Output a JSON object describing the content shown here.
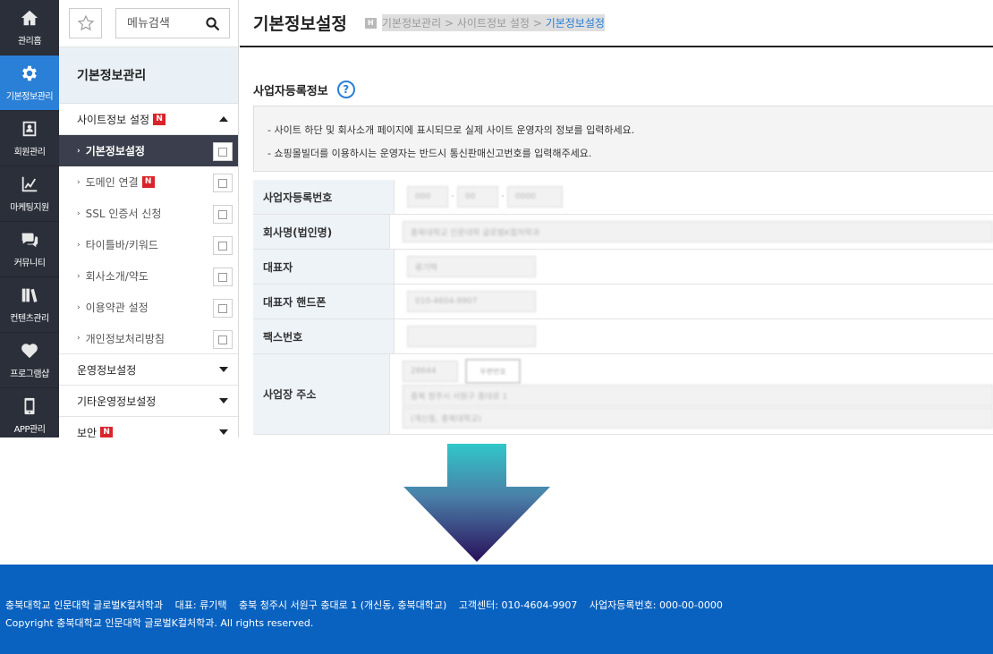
{
  "iconbar": {
    "items": [
      {
        "label": "관리홈",
        "icon": "home-icon"
      },
      {
        "label": "기본정보관리",
        "icon": "gear-icon"
      },
      {
        "label": "회원관리",
        "icon": "member-card-icon"
      },
      {
        "label": "마케팅지원",
        "icon": "chart-line-icon"
      },
      {
        "label": "커뮤니티",
        "icon": "chat-bubbles-icon"
      },
      {
        "label": "컨텐츠관리",
        "icon": "books-icon"
      },
      {
        "label": "프로그램샵",
        "icon": "heart-icon"
      },
      {
        "label": "APP관리",
        "icon": "phone-icon"
      }
    ],
    "active_color": "#2a7fd6"
  },
  "menu": {
    "search_placeholder": "메뉴검색",
    "title": "기본정보관리",
    "group1": {
      "label": "사이트정보 설정",
      "badge": "N"
    },
    "subs": [
      {
        "label": "기본정보설정"
      },
      {
        "label": "도메인 연결",
        "badge": "N"
      },
      {
        "label": "SSL 인증서 신청"
      },
      {
        "label": "타이틀바/키워드"
      },
      {
        "label": "회사소개/약도"
      },
      {
        "label": "이용약관 설정"
      },
      {
        "label": "개인정보처리방침"
      }
    ],
    "group2": {
      "label": "운영정보설정"
    },
    "group3": {
      "label": "기타운영정보설정"
    },
    "group4": {
      "label": "보안",
      "badge": "N"
    }
  },
  "content": {
    "title": "기본정보설정",
    "breadcrumb": {
      "home": "H",
      "c1": "기본정보관리",
      "sep": ">",
      "c2": "사이트정보 설정",
      "c3": "기본정보설정"
    },
    "section_title": "사업자등록정보",
    "help": "?",
    "notice": [
      "- 사이트 하단 및 회사소개 페이지에 표시되므로 실제 사이트 운영자의 정보를 입력하세요.",
      "- 쇼핑몰빌더를 이용하시는 운영자는 반드시 통신판매신고번호를 입력해주세요."
    ],
    "form": {
      "biz_no_label": "사업자등록번호",
      "biz_no": [
        "000",
        "00",
        "0000"
      ],
      "company_label": "회사명(법인명)",
      "company": "충북대학교 인문대학 글로벌K컬처학과",
      "ceo_label": "대표자",
      "ceo": "류기택",
      "phone_label": "대표자 핸드폰",
      "phone": "010-4604-9907",
      "fax_label": "팩스번호",
      "fax": "",
      "addr_label": "사업장 주소",
      "zip": "28644",
      "zip_button": "우편번호",
      "addr1": "충북 청주시 서원구 충대로 1",
      "addr2": "(개신동, 충북대학교)"
    }
  },
  "footer": {
    "company": "충북대학교 인문대학 글로벌K컬처학과",
    "ceo": "대표: 류기택",
    "address": "충북 청주시 서원구 충대로 1 (개신동, 충북대학교)",
    "cs": "고객센터: 010-4604-9907",
    "bizno": "사업자등록번호: 000-00-0000",
    "copyright": "Copyright 충북대학교 인문대학 글로벌K컬처학과. All rights reserved."
  }
}
